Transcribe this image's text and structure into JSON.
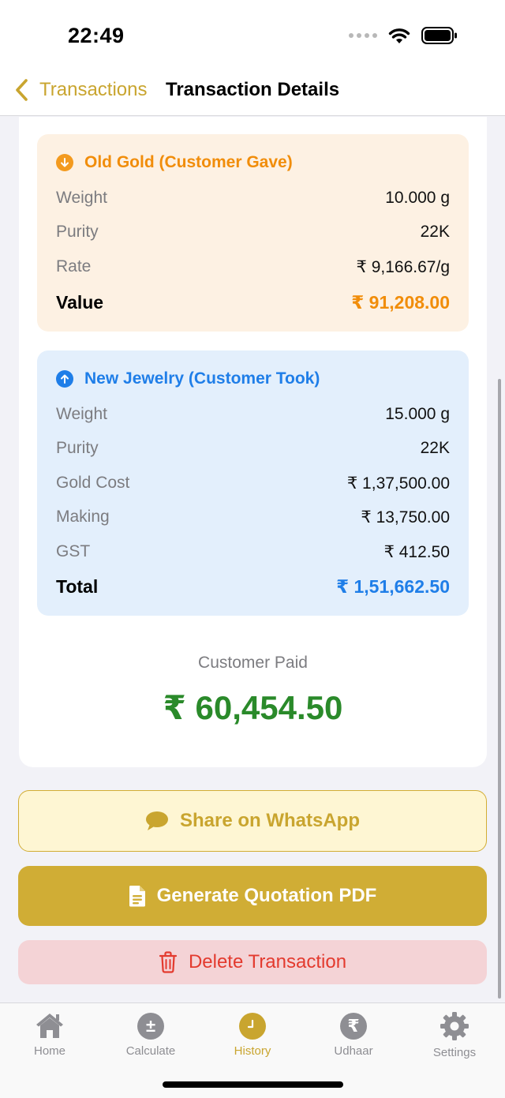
{
  "status": {
    "time": "22:49"
  },
  "nav": {
    "back_label": "Transactions",
    "title": "Transaction Details"
  },
  "old_gold": {
    "title": "Old Gold (Customer Gave)",
    "rows": [
      {
        "label": "Weight",
        "value": "10.000 g"
      },
      {
        "label": "Purity",
        "value": "22K"
      },
      {
        "label": "Rate",
        "value": "₹ 9,166.67/g"
      }
    ],
    "total": {
      "label": "Value",
      "value": "₹ 91,208.00"
    }
  },
  "new_jewelry": {
    "title": "New Jewelry (Customer Took)",
    "rows": [
      {
        "label": "Weight",
        "value": "15.000 g"
      },
      {
        "label": "Purity",
        "value": "22K"
      },
      {
        "label": "Gold Cost",
        "value": "₹ 1,37,500.00"
      },
      {
        "label": "Making",
        "value": "₹ 13,750.00"
      },
      {
        "label": "GST",
        "value": "₹ 412.50"
      }
    ],
    "total": {
      "label": "Total",
      "value": "₹ 1,51,662.50"
    }
  },
  "summary": {
    "paid_label": "Customer Paid",
    "paid_amount": "₹ 60,454.50"
  },
  "actions": {
    "whatsapp": "Share on WhatsApp",
    "pdf": "Generate Quotation PDF",
    "delete": "Delete Transaction"
  },
  "tabs": [
    {
      "label": "Home",
      "icon": "home-icon"
    },
    {
      "label": "Calculate",
      "icon": "plus-minus-icon"
    },
    {
      "label": "History",
      "icon": "clock-icon",
      "active": true
    },
    {
      "label": "Udhaar",
      "icon": "rupee-icon"
    },
    {
      "label": "Settings",
      "icon": "gear-icon"
    }
  ],
  "colors": {
    "accent": "#c9a52f",
    "old_gold": "#f18d0a",
    "new_jewelry": "#1f7ee8",
    "paid": "#2a8a2a",
    "delete": "#e33a2e"
  }
}
